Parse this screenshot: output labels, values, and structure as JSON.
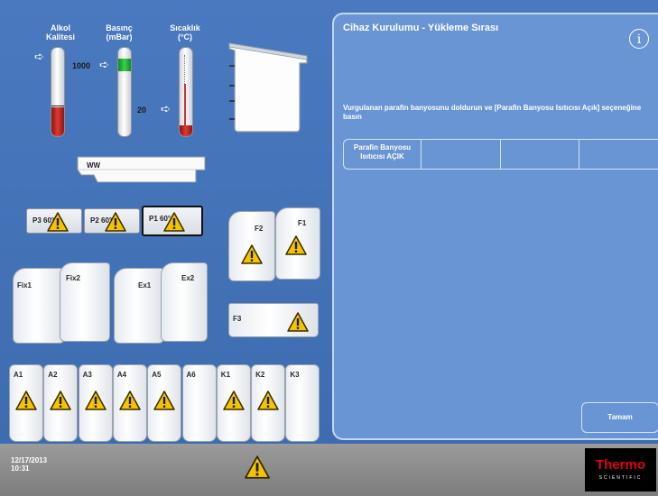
{
  "gauges": {
    "alcohol": {
      "label_line1": "Alkol",
      "label_line2": "Kalitesi"
    },
    "pressure": {
      "label_line1": "Basınç",
      "label_line2": "(mBar)",
      "value_high": "1000",
      "value_low": "20"
    },
    "temperature": {
      "label_line1": "Sıcaklık",
      "label_line2": "(°C)"
    }
  },
  "paraffin_baths": [
    {
      "label": "P3",
      "temp": "60°C"
    },
    {
      "label": "P2",
      "temp": "60°C"
    },
    {
      "label": "P1",
      "temp": "60°C"
    }
  ],
  "wax_tray_label": "WW",
  "formalin": [
    {
      "label": "F2"
    },
    {
      "label": "F1"
    },
    {
      "label": "F3"
    }
  ],
  "fixatives": [
    {
      "label": "Fix1"
    },
    {
      "label": "Fix2"
    }
  ],
  "exchangers": [
    {
      "label": "Ex1"
    },
    {
      "label": "Ex2"
    }
  ],
  "reagent_bottles": [
    {
      "label": "A1",
      "warning": true
    },
    {
      "label": "A2",
      "warning": true
    },
    {
      "label": "A3",
      "warning": true
    },
    {
      "label": "A4",
      "warning": true
    },
    {
      "label": "A5",
      "warning": true
    },
    {
      "label": "A6",
      "warning": false
    },
    {
      "label": "K1",
      "warning": true
    },
    {
      "label": "K2",
      "warning": true
    },
    {
      "label": "K3",
      "warning": false
    }
  ],
  "panel": {
    "title": "Cihaz Kurulumu - Yükleme Sırası",
    "info_glyph": "i",
    "instruction": "Vurgulanan parafin banyosunu doldurun ve [Parafin Banyosu Isıtıcısı Açık] seçeneğine basın",
    "heater_button_line1": "Parafin Banyosu",
    "heater_button_line2": "Isıtıcısı AÇIK",
    "ok_button": "Tamam"
  },
  "footer": {
    "date": "12/17/2013",
    "time": "10:31",
    "brand": "Thermo",
    "brand_sub": "SCIENTIFIC"
  },
  "colors": {
    "background": "#3f6eb3",
    "panel": "#6a95d4",
    "warning_fill": "#f5c400",
    "alcohol_fill": "#d9302a",
    "pressure_fill": "#22c03a",
    "temperature_fill": "#d9302a",
    "brand_red": "#e2001a"
  },
  "icons": {
    "warning": "warning-triangle-icon",
    "arrow": "arrow-right-icon",
    "info": "info-icon"
  }
}
